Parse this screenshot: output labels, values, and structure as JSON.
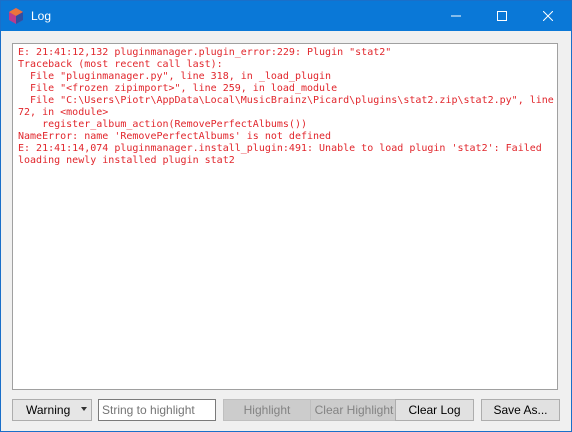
{
  "window": {
    "title": "Log",
    "icon": "picard-app-icon",
    "controls": [
      "minimize-icon",
      "maximize-icon",
      "close-icon"
    ]
  },
  "log": {
    "text_color": "#e1262c",
    "lines": [
      "E: 21:41:12,132 pluginmanager.plugin_error:229: Plugin \"stat2\"",
      "Traceback (most recent call last):",
      "  File \"pluginmanager.py\", line 318, in _load_plugin",
      "  File \"<frozen zipimport>\", line 259, in load_module",
      "  File \"C:\\Users\\Piotr\\AppData\\Local\\MusicBrainz\\Picard\\plugins\\stat2.zip\\stat2.py\", line",
      "72, in <module>",
      "    register_album_action(RemovePerfectAlbums())",
      "NameError: name 'RemovePerfectAlbums' is not defined",
      "E: 21:41:14,074 pluginmanager.install_plugin:491: Unable to load plugin 'stat2': Failed",
      "loading newly installed plugin stat2"
    ]
  },
  "bottom": {
    "level_select": "Warning",
    "highlight_placeholder": "String to highlight",
    "highlight_button": "Highlight",
    "clear_highlight_button": "Clear Highlight",
    "clear_log_button": "Clear Log",
    "save_as_button": "Save As..."
  },
  "colors": {
    "titlebar": "#0a78d7",
    "log_text": "#e1262c"
  }
}
